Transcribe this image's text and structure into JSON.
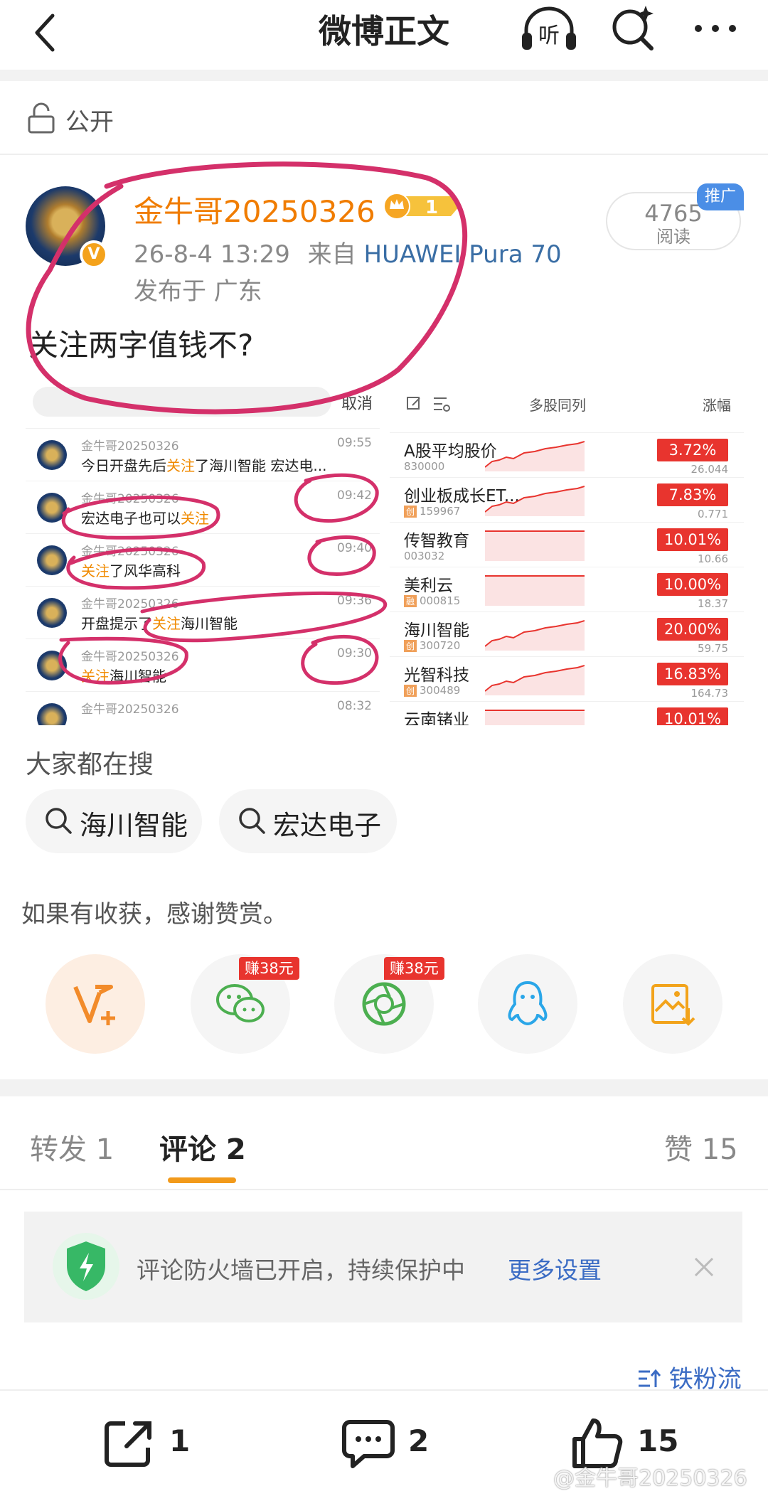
{
  "header": {
    "title": "微博正文"
  },
  "visibility": {
    "label": "公开"
  },
  "author": {
    "name": "金牛哥20250326",
    "date": "26-8-4 13:29",
    "source_prefix": "来自",
    "device": "HUAWEI Pura 70",
    "location": "发布于 广东",
    "verified_mark": "V"
  },
  "reads": {
    "count": "4765",
    "label": "阅读",
    "promo": "推广"
  },
  "post": {
    "text": "关注两字值钱不?"
  },
  "screenshot": {
    "cancel": "取消",
    "messages": [
      {
        "name": "金牛哥20250326",
        "pre": "今日开盘先后",
        "hl": "关注",
        "post": "了海川智能  宏达电...",
        "time": "09:55"
      },
      {
        "name": "金牛哥20250326",
        "pre": "宏达电子也可以",
        "hl": "关注",
        "post": "",
        "time": "09:42"
      },
      {
        "name": "金牛哥20250326",
        "pre": "",
        "hl": "关注",
        "post": "了风华高科",
        "time": "09:40"
      },
      {
        "name": "金牛哥20250326",
        "pre": "开盘提示了",
        "hl": "关注",
        "post": "海川智能",
        "time": "09:36"
      },
      {
        "name": "金牛哥20250326",
        "pre": "",
        "hl": "关注",
        "post": "海川智能",
        "time": "09:30"
      },
      {
        "name": "金牛哥20250326",
        "pre": "",
        "hl": "",
        "post": "",
        "time": "08:32"
      }
    ],
    "list_header": {
      "compare": "多股同列",
      "change": "涨幅"
    },
    "stocks": [
      {
        "name": "A股平均股价",
        "code": "830000",
        "tag": "",
        "pct": "3.72%",
        "price": "26.044"
      },
      {
        "name": "创业板成长ET...",
        "code": "159967",
        "tag": "创",
        "pct": "7.83%",
        "price": "0.771"
      },
      {
        "name": "传智教育",
        "code": "003032",
        "tag": "",
        "pct": "10.01%",
        "price": "10.66"
      },
      {
        "name": "美利云",
        "code": "000815",
        "tag": "融",
        "pct": "10.00%",
        "price": "18.37"
      },
      {
        "name": "海川智能",
        "code": "300720",
        "tag": "创",
        "pct": "20.00%",
        "price": "59.75"
      },
      {
        "name": "光智科技",
        "code": "300489",
        "tag": "创",
        "pct": "16.83%",
        "price": "164.73"
      },
      {
        "name": "云南锗业",
        "code": "",
        "tag": "",
        "pct": "10.01%",
        "price": ""
      }
    ]
  },
  "hot_search": {
    "title": "大家都在搜",
    "items": [
      "海川智能",
      "宏达电子"
    ]
  },
  "reward": {
    "text": "如果有收获，感谢赞赏。",
    "earn_label": "赚38元",
    "icons": [
      "vplus-icon",
      "wechat-icon",
      "moments-icon",
      "qq-icon",
      "save-image-icon"
    ]
  },
  "tabs": {
    "repost": "转发 1",
    "comment": "评论 2",
    "like": "赞 15"
  },
  "firewall": {
    "text": "评论防火墙已开启，持续保护中",
    "link": "更多设置"
  },
  "sort": {
    "label": "铁粉流"
  },
  "bottom": {
    "repost_count": "1",
    "comment_count": "2",
    "like_count": "15"
  },
  "watermark": "@金牛哥20250326",
  "colors": {
    "accent": "#f29a1b",
    "username": "#f07c00",
    "link": "#3b6cc4",
    "red": "#e8342e"
  }
}
